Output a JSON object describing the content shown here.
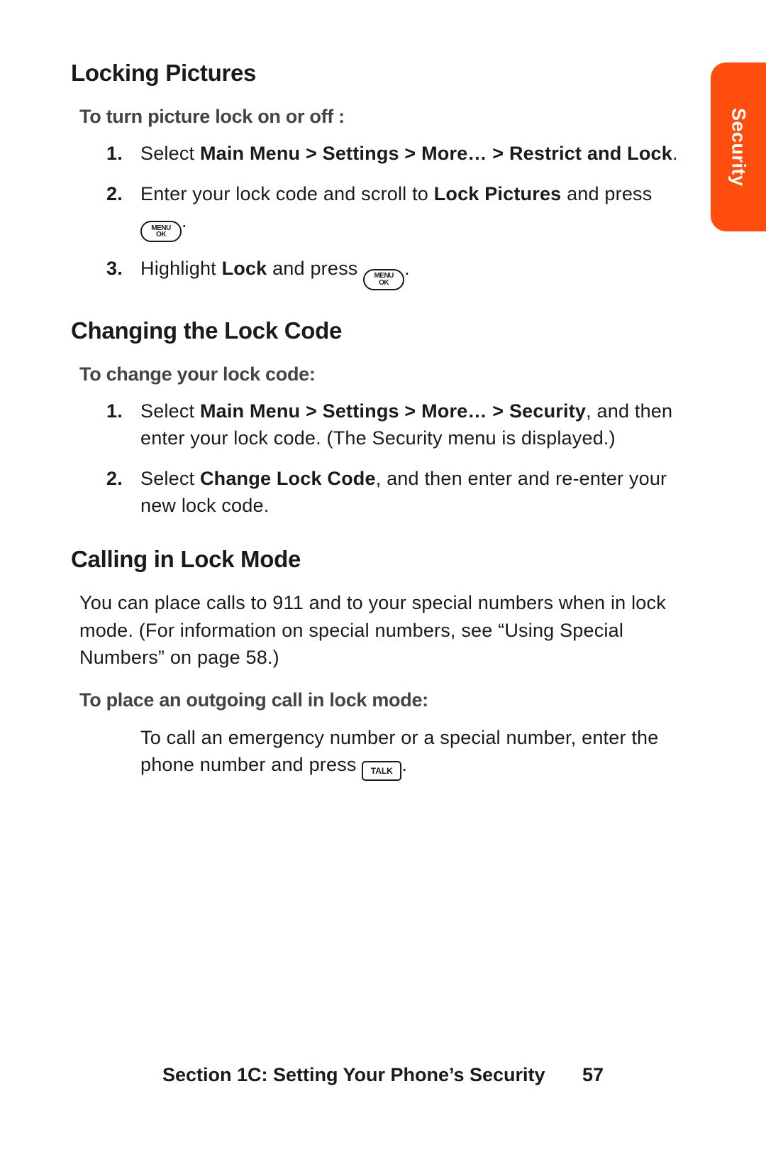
{
  "sideTab": "Security",
  "key": {
    "menu_top": "MENU",
    "menu_bottom": "OK",
    "talk": "TALK"
  },
  "s1": {
    "title": "Locking Pictures",
    "sub": "To turn picture lock on or off :",
    "st1_n": "1.",
    "st1_a": "Select ",
    "st1_b": "Main Menu > Settings > More… > Restrict and Lock",
    "st1_c": ".",
    "st2_n": "2.",
    "st2_a": "Enter your lock code and scroll to ",
    "st2_b": "Lock Pictures",
    "st2_c": " and press ",
    "st2_d": ".",
    "st3_n": "3.",
    "st3_a": "Highlight ",
    "st3_b": "Lock",
    "st3_c": " and press ",
    "st3_d": "."
  },
  "s2": {
    "title": "Changing the Lock Code",
    "sub": "To change your lock code:",
    "st1_n": "1.",
    "st1_a": "Select ",
    "st1_b": "Main Menu > Settings > More… > Security",
    "st1_c": ", and then enter your lock code. (The Security menu is displayed.)",
    "st2_n": "2.",
    "st2_a": "Select ",
    "st2_b": "Change Lock Code",
    "st2_c": ", and then enter and re-enter your new lock code."
  },
  "s3": {
    "title": "Calling in Lock Mode",
    "para": "You can place calls to 911 and to your special numbers when in lock mode. (For information on special numbers, see “Using Special Numbers” on page 58.)",
    "sub": "To place an outgoing call in lock mode:",
    "body_a": "To call an emergency number or a special number, enter the phone number and press ",
    "body_b": "."
  },
  "footer": {
    "section": "Section 1C: Setting Your Phone’s Security",
    "page": "57"
  }
}
